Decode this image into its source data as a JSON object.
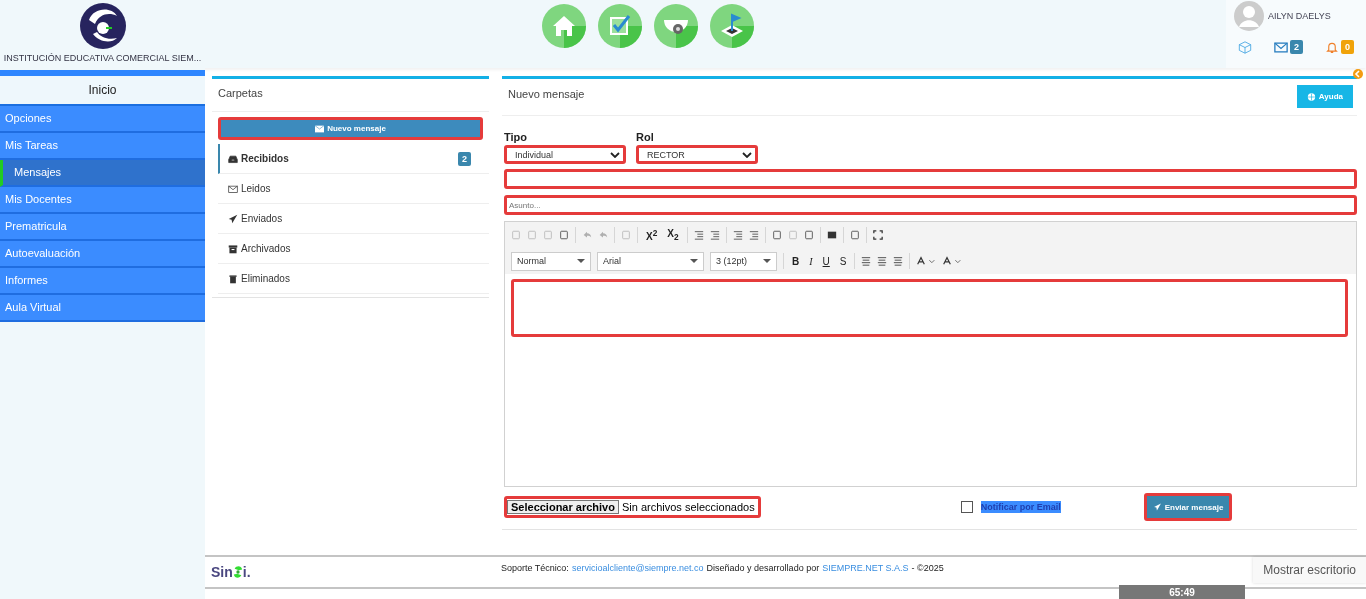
{
  "header": {
    "school_name": "INSTITUCIÓN EDUCATIVA COMERCIAL SIEM...",
    "user_name": "AILYN DAELYS",
    "mail_count": "2",
    "alert_count": "0"
  },
  "sidebar": {
    "title": "Inicio",
    "items": [
      {
        "label": "Opciones",
        "selected": false
      },
      {
        "label": "Mis Tareas",
        "selected": false
      },
      {
        "label": "Mensajes",
        "selected": true
      },
      {
        "label": "Mis Docentes",
        "selected": false
      },
      {
        "label": "Prematricula",
        "selected": false
      },
      {
        "label": "Autoevaluación",
        "selected": false
      },
      {
        "label": "Informes",
        "selected": false
      },
      {
        "label": "Aula Virtual",
        "selected": false
      }
    ]
  },
  "folders": {
    "title": "Carpetas",
    "new_button": "Nuevo mensaje",
    "items": [
      {
        "kind": "inbox",
        "label": "Recibidos",
        "selected": true,
        "count": "2"
      },
      {
        "kind": "envelope",
        "label": "Leidos",
        "selected": false
      },
      {
        "kind": "send",
        "label": "Enviados",
        "selected": false
      },
      {
        "kind": "archive",
        "label": "Archivados",
        "selected": false
      },
      {
        "kind": "trash",
        "label": "Eliminados",
        "selected": false
      }
    ]
  },
  "compose": {
    "title": "Nuevo mensaje",
    "help_button": "Ayuda",
    "tipo_label": "Tipo",
    "tipo_value": "Individual",
    "rol_label": "Rol",
    "rol_value": "RECTOR",
    "subject_placeholder": "Asunto...",
    "editor": {
      "superscript": "X$^{2}$",
      "subscript": "X$_{2}$",
      "format": "Normal",
      "font": "Arial",
      "size": "3 (12pt)",
      "bold": "B",
      "italic": "I",
      "underline": "U",
      "strike": "S"
    },
    "file_button": "Seleccionar archivo",
    "file_status": "Sin archivos seleccionados",
    "notify_label": "Notificar por Email",
    "notify_checked": false,
    "send_button": "Enviar mensaje"
  },
  "footer": {
    "logo_left": "Sin",
    "logo_right": "i.",
    "support_label": "Soporte Técnico:",
    "support_email": "servicioalcliente@siempre.net.co",
    "designed_by": "Diseñado y desarrollado por",
    "company": "SIEMPRE.NET S.A.S",
    "copyright": "- ©2025"
  },
  "show_desktop": "Mostrar escritorio",
  "timer": "65:49"
}
